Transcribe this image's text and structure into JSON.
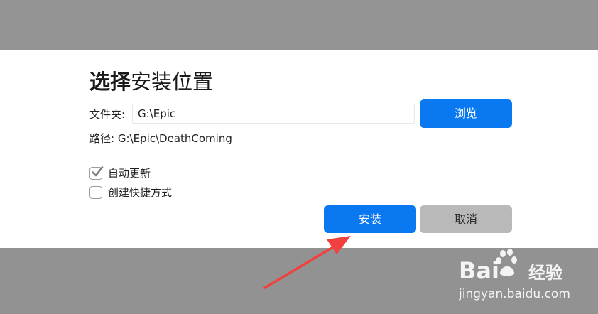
{
  "dialog": {
    "title_strong": "选择",
    "title_rest": "安装位置",
    "folder_label": "文件夹:",
    "folder_value": "G:\\Epic",
    "browse_label": "浏览",
    "path_label": "路径:",
    "path_value": "G:\\Epic\\DeathComing",
    "options": [
      {
        "label": "自动更新",
        "checked": true
      },
      {
        "label": "创建快捷方式",
        "checked": false
      }
    ],
    "install_label": "安装",
    "cancel_label": "取消"
  },
  "annotation": {
    "color": "#f0413e"
  },
  "watermark": {
    "brand_left": "Bai",
    "brand_right": "经验",
    "url": "jingyan.baidu.com"
  },
  "colors": {
    "primary": "#0a78f0",
    "secondary": "#b9b9b9",
    "backdrop": "#939393"
  }
}
